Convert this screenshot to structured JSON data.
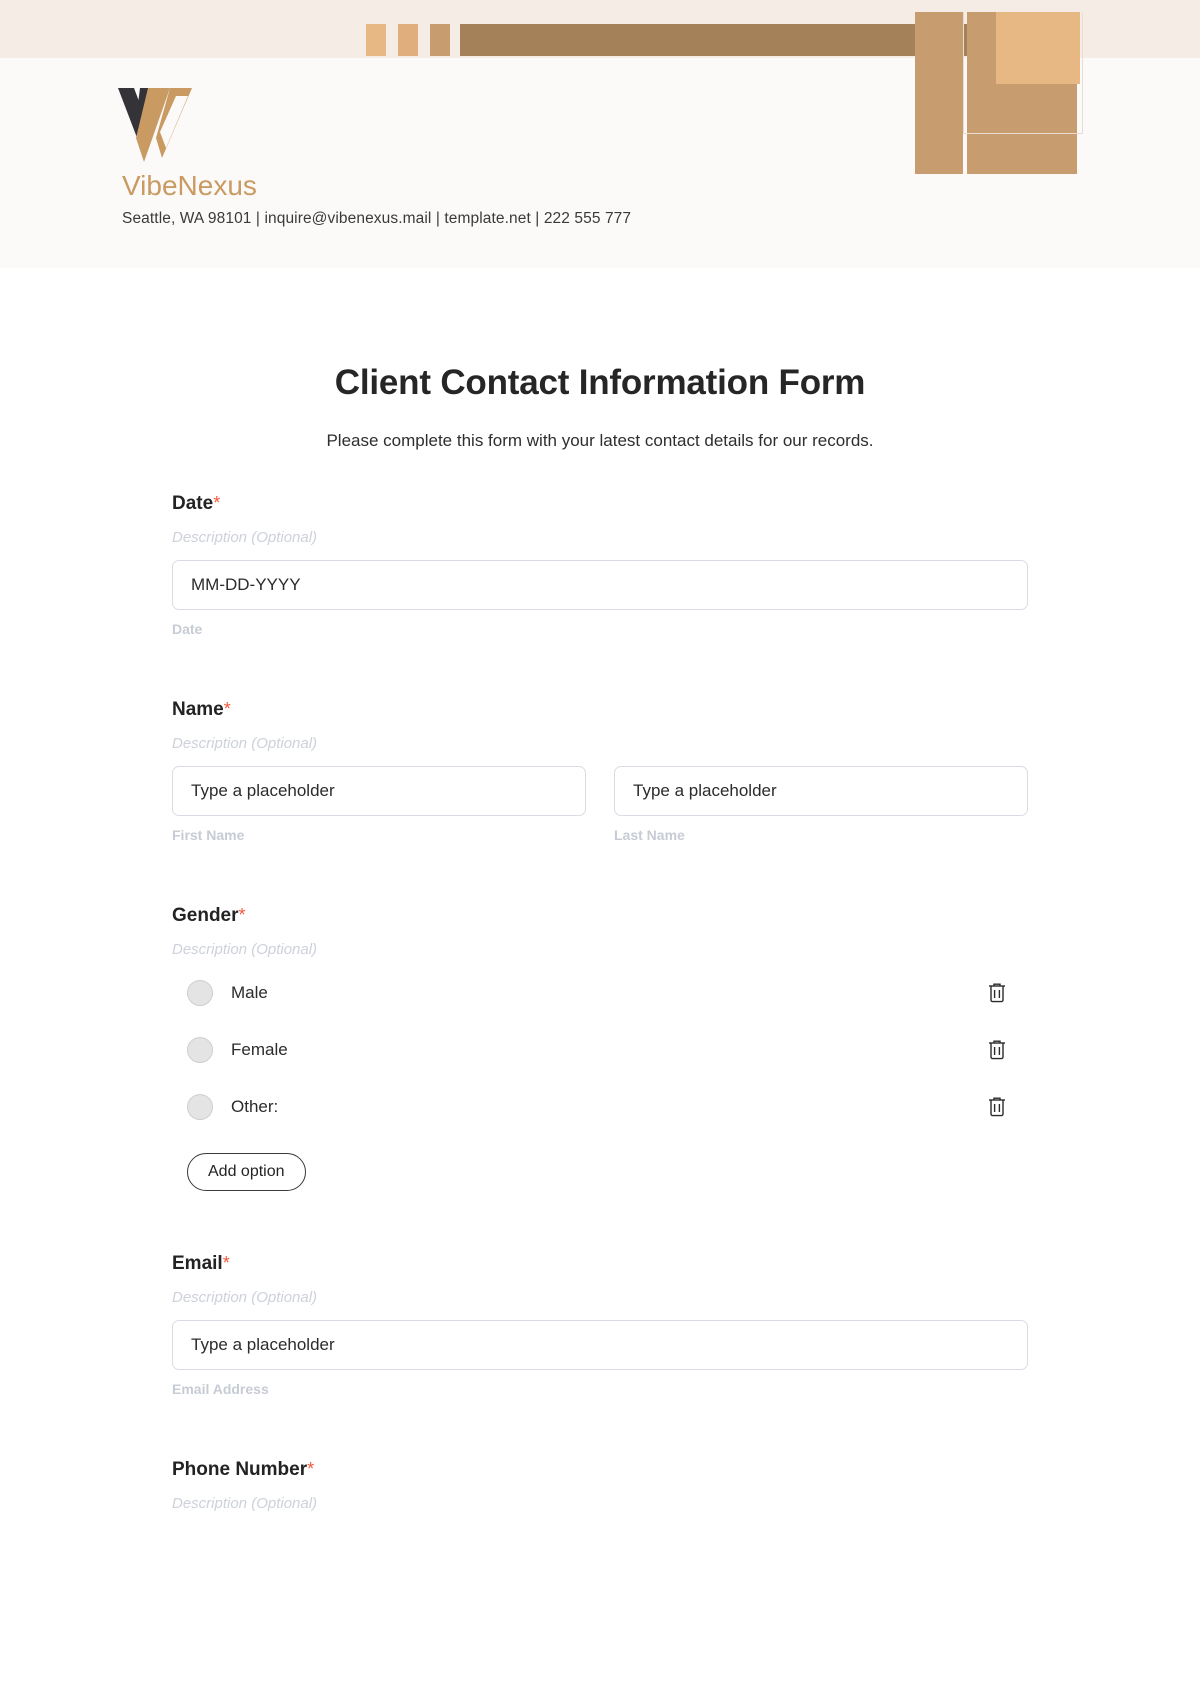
{
  "brand": {
    "name": "VibeNexus",
    "contact_line": "Seattle, WA 98101 | inquire@vibenexus.mail | template.net | 222 555 777",
    "accent_color": "#c99a62",
    "bar_color": "#a5815a",
    "block_color": "#c79c6e",
    "light_block_color": "#e8b884",
    "header_band_color": "#f4ece5"
  },
  "form": {
    "title": "Client Contact Information Form",
    "subtitle": "Please complete this form with your latest contact details for our records.",
    "required_marker": "*",
    "description_placeholder": "Description (Optional)"
  },
  "fields": [
    {
      "label": "Date",
      "required": true,
      "description": "Description (Optional)",
      "inputs": [
        {
          "placeholder": "MM-DD-YYYY",
          "sub_label": "Date"
        }
      ]
    },
    {
      "label": "Name",
      "required": true,
      "description": "Description (Optional)",
      "inputs": [
        {
          "placeholder": "Type a placeholder",
          "sub_label": "First Name"
        },
        {
          "placeholder": "Type a placeholder",
          "sub_label": "Last Name"
        }
      ]
    },
    {
      "label": "Gender",
      "required": true,
      "description": "Description (Optional)",
      "options": [
        "Male",
        "Female",
        "Other:"
      ],
      "add_option_label": "Add option"
    },
    {
      "label": "Email",
      "required": true,
      "description": "Description (Optional)",
      "inputs": [
        {
          "placeholder": "Type a placeholder",
          "sub_label": "Email Address"
        }
      ]
    },
    {
      "label": "Phone Number",
      "required": true,
      "description": "Description (Optional)",
      "inputs": []
    }
  ]
}
